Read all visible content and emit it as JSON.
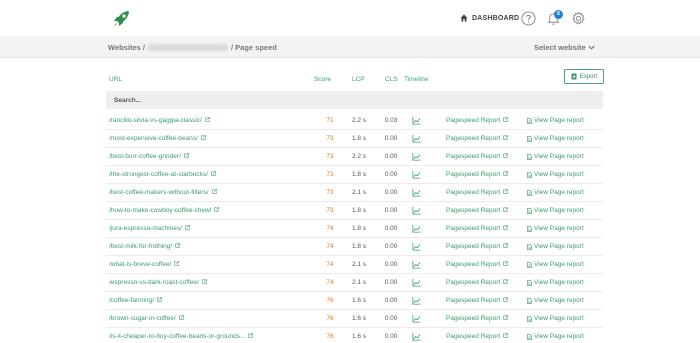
{
  "header": {
    "dashboard_label": "DASHBOARD",
    "notification_count": "6",
    "accent_color": "#3f9a70"
  },
  "breadcrumb": {
    "root": "Websites /",
    "site_redacted": "",
    "current": "/ Page speed"
  },
  "site_selector": {
    "label": "Select website"
  },
  "toolbar": {
    "export_label": "Export"
  },
  "table": {
    "columns": {
      "url": "URL",
      "score": "Score",
      "lcp": "LCP",
      "cls": "CLS",
      "timeline": "Timeline"
    },
    "search_placeholder": "Search...",
    "pagespeed_link_label": "Pagespeed Report",
    "view_link_label": "View Page report",
    "rows": [
      {
        "url": "/rancilio-silvia-vs-gaggia-classic/",
        "score": "71",
        "lcp": "2.2 s",
        "cls": "0.03"
      },
      {
        "url": "/most-expensive-coffee-beans/",
        "score": "73",
        "lcp": "1.8 s",
        "cls": "0.00"
      },
      {
        "url": "/best-burr-coffee-grinder/",
        "score": "73",
        "lcp": "2.2 s",
        "cls": "0.00"
      },
      {
        "url": "/the-strongest-coffee-at-starbucks/",
        "score": "73",
        "lcp": "1.8 s",
        "cls": "0.00"
      },
      {
        "url": "/best-coffee-makers-without-filters/",
        "score": "73",
        "lcp": "2.1 s",
        "cls": "0.00"
      },
      {
        "url": "/how-to-make-cowboy-coffee-chew/",
        "score": "73",
        "lcp": "1.8 s",
        "cls": "0.00"
      },
      {
        "url": "/jura-espresso-machines/",
        "score": "74",
        "lcp": "1.8 s",
        "cls": "0.00"
      },
      {
        "url": "/best-milk-for-frothing/",
        "score": "74",
        "lcp": "1.8 s",
        "cls": "0.00"
      },
      {
        "url": "/what-is-breve-coffee/",
        "score": "74",
        "lcp": "2.1 s",
        "cls": "0.00"
      },
      {
        "url": "/espresso-vs-dark-roast-coffee/",
        "score": "74",
        "lcp": "2.1 s",
        "cls": "0.00"
      },
      {
        "url": "/coffee-farming/",
        "score": "76",
        "lcp": "1.6 s",
        "cls": "0.00"
      },
      {
        "url": "/brown-sugar-in-coffee/",
        "score": "76",
        "lcp": "1.6 s",
        "cls": "0.00"
      },
      {
        "url": "/is-it-cheaper-to-buy-coffee-beans-or-grounds...",
        "score": "76",
        "lcp": "1.6 s",
        "cls": "0.00"
      }
    ]
  }
}
